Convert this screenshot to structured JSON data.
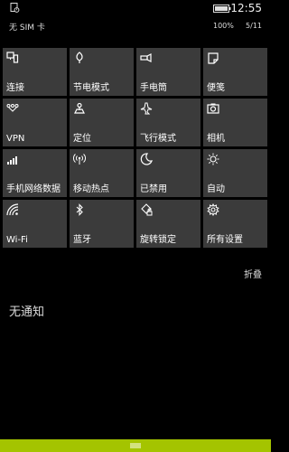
{
  "status": {
    "time": "12:55",
    "sim": "无 SIM 卡",
    "battery_pct": "100%",
    "date": "5/11",
    "battery_level": 1.0,
    "left_icon": "device-icon"
  },
  "tiles": [
    {
      "label": "连接",
      "icon": "connect-icon"
    },
    {
      "label": "节电模式",
      "icon": "battery-saver-icon"
    },
    {
      "label": "手电筒",
      "icon": "flashlight-icon"
    },
    {
      "label": "便笺",
      "icon": "note-icon"
    },
    {
      "label": "VPN",
      "icon": "vpn-icon"
    },
    {
      "label": "定位",
      "icon": "location-icon"
    },
    {
      "label": "飞行模式",
      "icon": "airplane-icon"
    },
    {
      "label": "相机",
      "icon": "camera-icon"
    },
    {
      "label": "手机网络数据",
      "icon": "cellular-icon"
    },
    {
      "label": "移动热点",
      "icon": "hotspot-icon"
    },
    {
      "label": "已禁用",
      "icon": "moon-icon"
    },
    {
      "label": "自动",
      "icon": "brightness-icon"
    },
    {
      "label": "Wi-Fi",
      "icon": "wifi-icon"
    },
    {
      "label": "蓝牙",
      "icon": "bluetooth-icon"
    },
    {
      "label": "旋转锁定",
      "icon": "rotation-lock-icon"
    },
    {
      "label": "所有设置",
      "icon": "gear-icon"
    }
  ],
  "collapse_label": "折叠",
  "notifications_empty": "无通知",
  "accent_color": "#a4c400"
}
